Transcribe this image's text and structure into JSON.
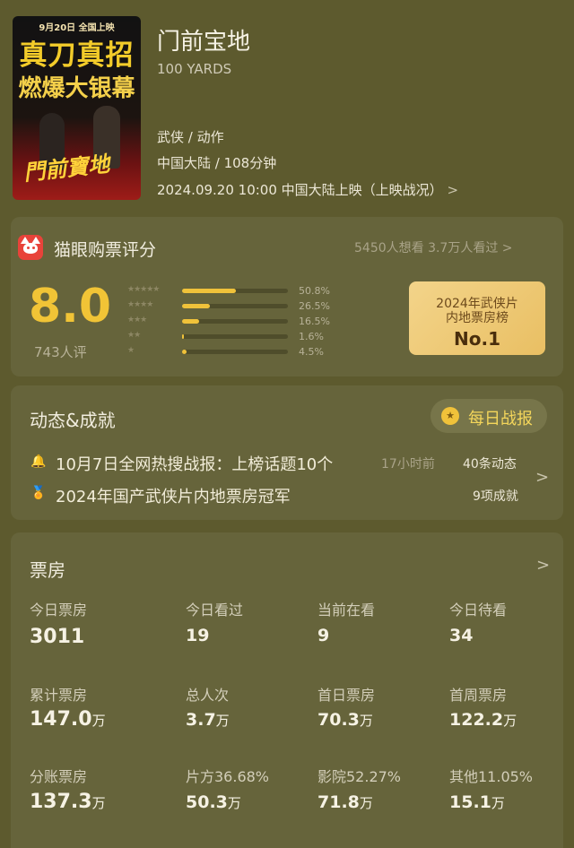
{
  "poster": {
    "top_text": "9月20日 全国上映",
    "line1": "真刀真招",
    "line2": "燃爆大银幕",
    "line3": "門前寶地"
  },
  "movie": {
    "title": "门前宝地",
    "english_title": "100 YARDS",
    "genre": "武侠 / 动作",
    "region_duration": "中国大陆 / 108分钟",
    "release": "2024.09.20 10:00 中国大陆上映（上映战况）",
    "release_chevron": ">"
  },
  "rating": {
    "section_title": "猫眼购票评分",
    "want_watched": "5450人想看 3.7万人看过",
    "chevron": ">",
    "score": "8.0",
    "raters": "743人评",
    "distribution": [
      {
        "stars": "★★★★★",
        "fraction": 0.508,
        "percent": "50.8%"
      },
      {
        "stars": "★★★★",
        "fraction": 0.265,
        "percent": "26.5%"
      },
      {
        "stars": "★★★",
        "fraction": 0.165,
        "percent": "16.5%"
      },
      {
        "stars": "★★",
        "fraction": 0.016,
        "percent": "1.6%"
      },
      {
        "stars": "★",
        "fraction": 0.045,
        "percent": "4.5%"
      }
    ],
    "badge": {
      "line1": "2024年武侠片",
      "line2": "内地票房榜",
      "rank": "No.1"
    }
  },
  "news": {
    "section_title": "动态&成就",
    "daily_button": "每日战报",
    "row1": {
      "text": "10月7日全网热搜战报：上榜话题10个",
      "time": "17小时前",
      "count": "40条动态"
    },
    "row2": {
      "text": "2024年国产武侠片内地票房冠军",
      "count": "9项成就"
    },
    "chevron": ">"
  },
  "box_office": {
    "section_title": "票房",
    "chevron": ">",
    "cells": [
      {
        "label": "今日票房",
        "value": "3011",
        "unit": ""
      },
      {
        "label": "今日看过",
        "value": "19",
        "unit": ""
      },
      {
        "label": "当前在看",
        "value": "9",
        "unit": ""
      },
      {
        "label": "今日待看",
        "value": "34",
        "unit": ""
      },
      {
        "label": "累计票房",
        "value": "147.0",
        "unit": "万"
      },
      {
        "label": "总人次",
        "value": "3.7",
        "unit": "万"
      },
      {
        "label": "首日票房",
        "value": "70.3",
        "unit": "万"
      },
      {
        "label": "首周票房",
        "value": "122.2",
        "unit": "万"
      },
      {
        "label": "分账票房",
        "value": "137.3",
        "unit": "万"
      },
      {
        "label": "片方36.68%",
        "value": "50.3",
        "unit": "万"
      },
      {
        "label": "影院52.27%",
        "value": "71.8",
        "unit": "万"
      },
      {
        "label": "其他11.05%",
        "value": "15.1",
        "unit": "万"
      }
    ]
  },
  "colors": {
    "background": "#5d5a2e",
    "card": "#66643b",
    "accent_gold": "#f1c436",
    "brand_red": "#e8433a"
  }
}
